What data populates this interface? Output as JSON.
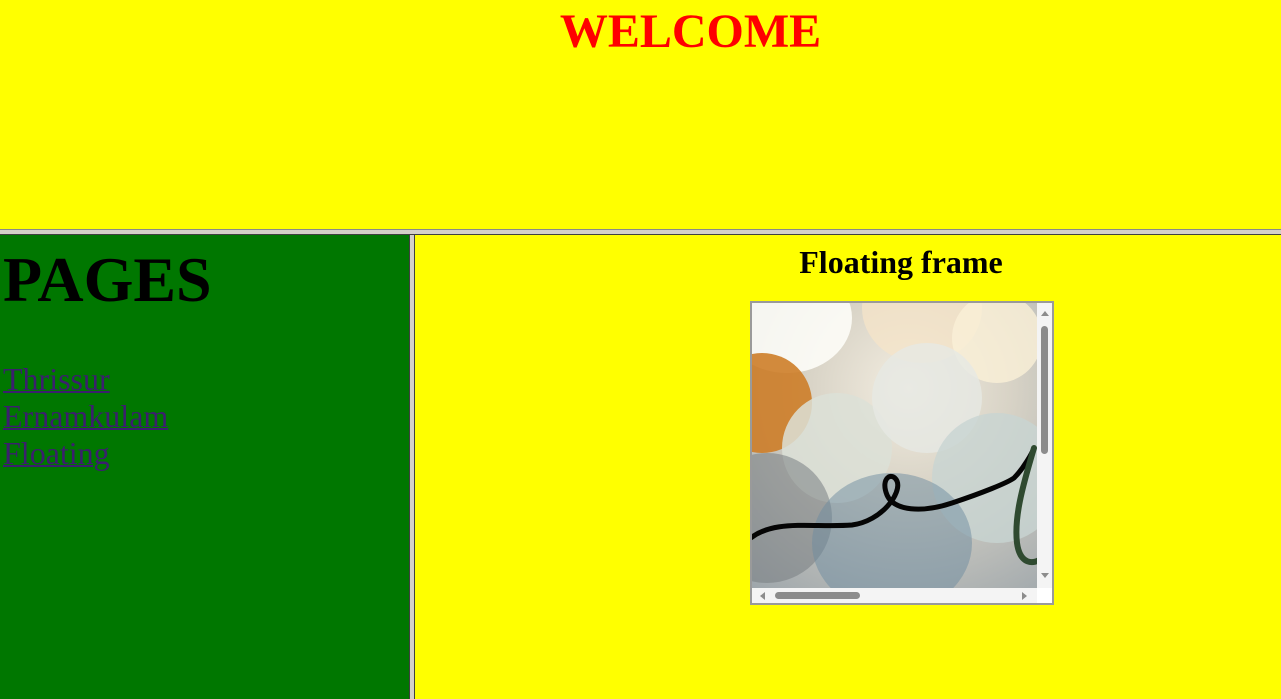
{
  "top": {
    "title": "WELCOME",
    "title_color": "#ff0000",
    "background": "#ffff00"
  },
  "sidebar": {
    "heading": "PAGES",
    "background": "#007700",
    "links": [
      {
        "label": "Thrissur"
      },
      {
        "label": "Ernamkulam"
      },
      {
        "label": "Floating"
      }
    ]
  },
  "main": {
    "heading": "Floating frame",
    "background": "#ffff00",
    "iframe": {
      "content": "bokeh-image",
      "vertical_scroll": "scrollbar-vertical",
      "horizontal_scroll": "scrollbar-horizontal"
    }
  }
}
